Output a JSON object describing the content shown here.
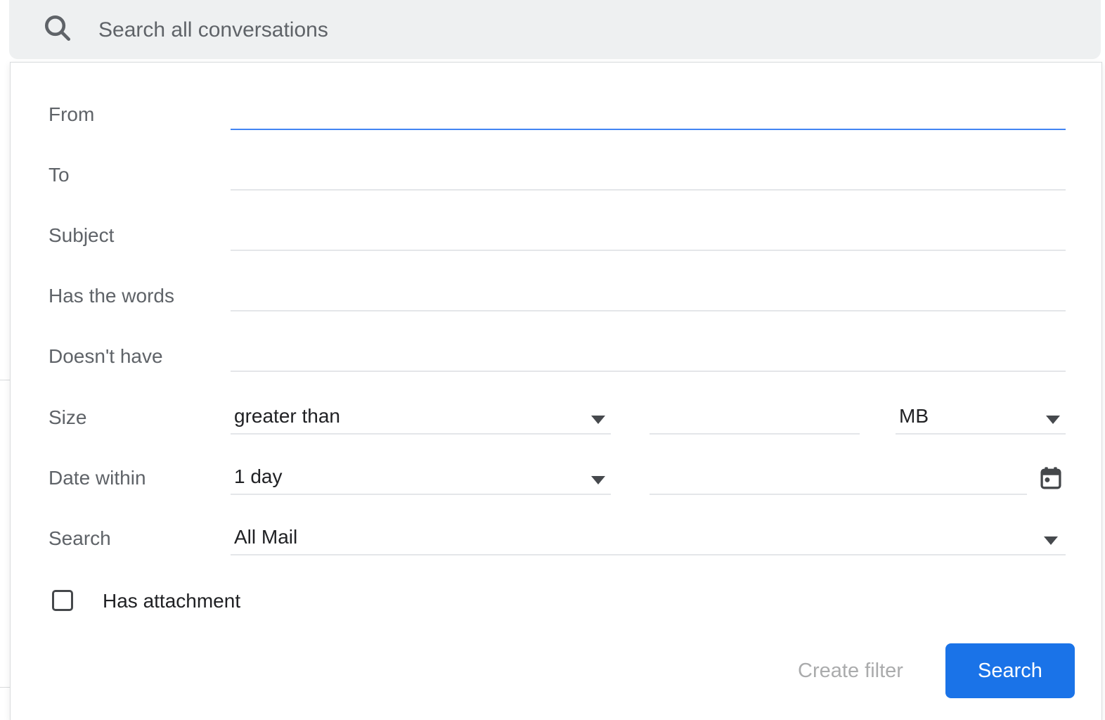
{
  "search_bar": {
    "placeholder": "Search all conversations",
    "value": "",
    "icon": "search-icon"
  },
  "filter_panel": {
    "text_fields": [
      {
        "label": "From",
        "value": "",
        "focused": true
      },
      {
        "label": "To",
        "value": "",
        "focused": false
      },
      {
        "label": "Subject",
        "value": "",
        "focused": false
      },
      {
        "label": "Has the words",
        "value": "",
        "focused": false
      },
      {
        "label": "Doesn't have",
        "value": "",
        "focused": false
      }
    ],
    "size_row": {
      "label": "Size",
      "comparator": "greater than",
      "amount": "",
      "unit": "MB"
    },
    "date_row": {
      "label": "Date within",
      "range": "1 day",
      "date_value": "",
      "icon": "calendar-icon"
    },
    "scope_row": {
      "label": "Search",
      "value": "All Mail"
    },
    "attachment_row": {
      "label": "Has attachment",
      "checked": false
    },
    "actions": {
      "create_filter_label": "Create filter",
      "search_label": "Search"
    }
  },
  "colors": {
    "accent_button": "#1a73e8",
    "focused_underline": "#4285f4",
    "label_gray": "#5f6368",
    "value_dark": "#202124",
    "searchbar_bg": "#eef0f1",
    "underline_gray": "#e4e6e9"
  }
}
